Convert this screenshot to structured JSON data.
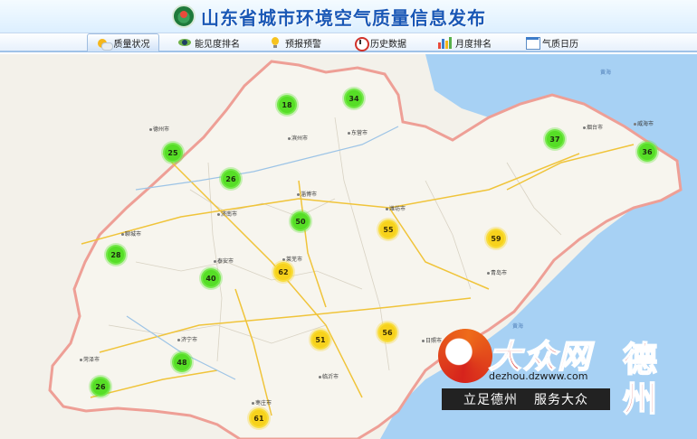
{
  "header": {
    "title": "山东省城市环境空气质量信息发布"
  },
  "nav": {
    "tabs": [
      {
        "label": "质量状况",
        "icon": "sun-cloud-icon",
        "active": true
      },
      {
        "label": "能见度排名",
        "icon": "eye-icon",
        "active": false
      },
      {
        "label": "预报预警",
        "icon": "bulb-icon",
        "active": false
      },
      {
        "label": "历史数据",
        "icon": "clock-icon",
        "active": false
      },
      {
        "label": "月度排名",
        "icon": "bar-chart-icon",
        "active": false
      },
      {
        "label": "气质日历",
        "icon": "calendar-icon",
        "active": false
      }
    ]
  },
  "colors": {
    "good": "#56de26",
    "moderate": "#f7d21c",
    "sea": "#a7d1f4",
    "land": "#f7f5ee",
    "border": "#ee9f96"
  },
  "map": {
    "stations": [
      {
        "value": "18",
        "level": "green"
      },
      {
        "value": "34",
        "level": "green"
      },
      {
        "value": "25",
        "level": "green"
      },
      {
        "value": "26",
        "level": "green"
      },
      {
        "value": "37",
        "level": "green"
      },
      {
        "value": "36",
        "level": "green"
      },
      {
        "value": "50",
        "level": "green"
      },
      {
        "value": "55",
        "level": "yellow"
      },
      {
        "value": "59",
        "level": "yellow"
      },
      {
        "value": "28",
        "level": "green"
      },
      {
        "value": "40",
        "level": "green"
      },
      {
        "value": "62",
        "level": "yellow"
      },
      {
        "value": "51",
        "level": "yellow"
      },
      {
        "value": "56",
        "level": "yellow"
      },
      {
        "value": "48",
        "level": "green"
      },
      {
        "value": "26",
        "level": "green"
      },
      {
        "value": "61",
        "level": "yellow"
      }
    ],
    "cities": [
      "德州市",
      "滨州市",
      "东营市",
      "烟台市",
      "威海市",
      "济南市",
      "淄博市",
      "潍坊市",
      "聊城市",
      "泰安市",
      "莱芜市",
      "青岛市",
      "济宁市",
      "日照市",
      "菏泽市",
      "临沂市",
      "枣庄市"
    ],
    "seas": [
      "黄海",
      "黄海"
    ]
  },
  "watermark": {
    "brand": "大众网",
    "url": "dezhou.dzwww.com",
    "slogan_left": "立足德州",
    "slogan_right": "服务大众",
    "city_top": "德",
    "city_bottom": "州"
  }
}
